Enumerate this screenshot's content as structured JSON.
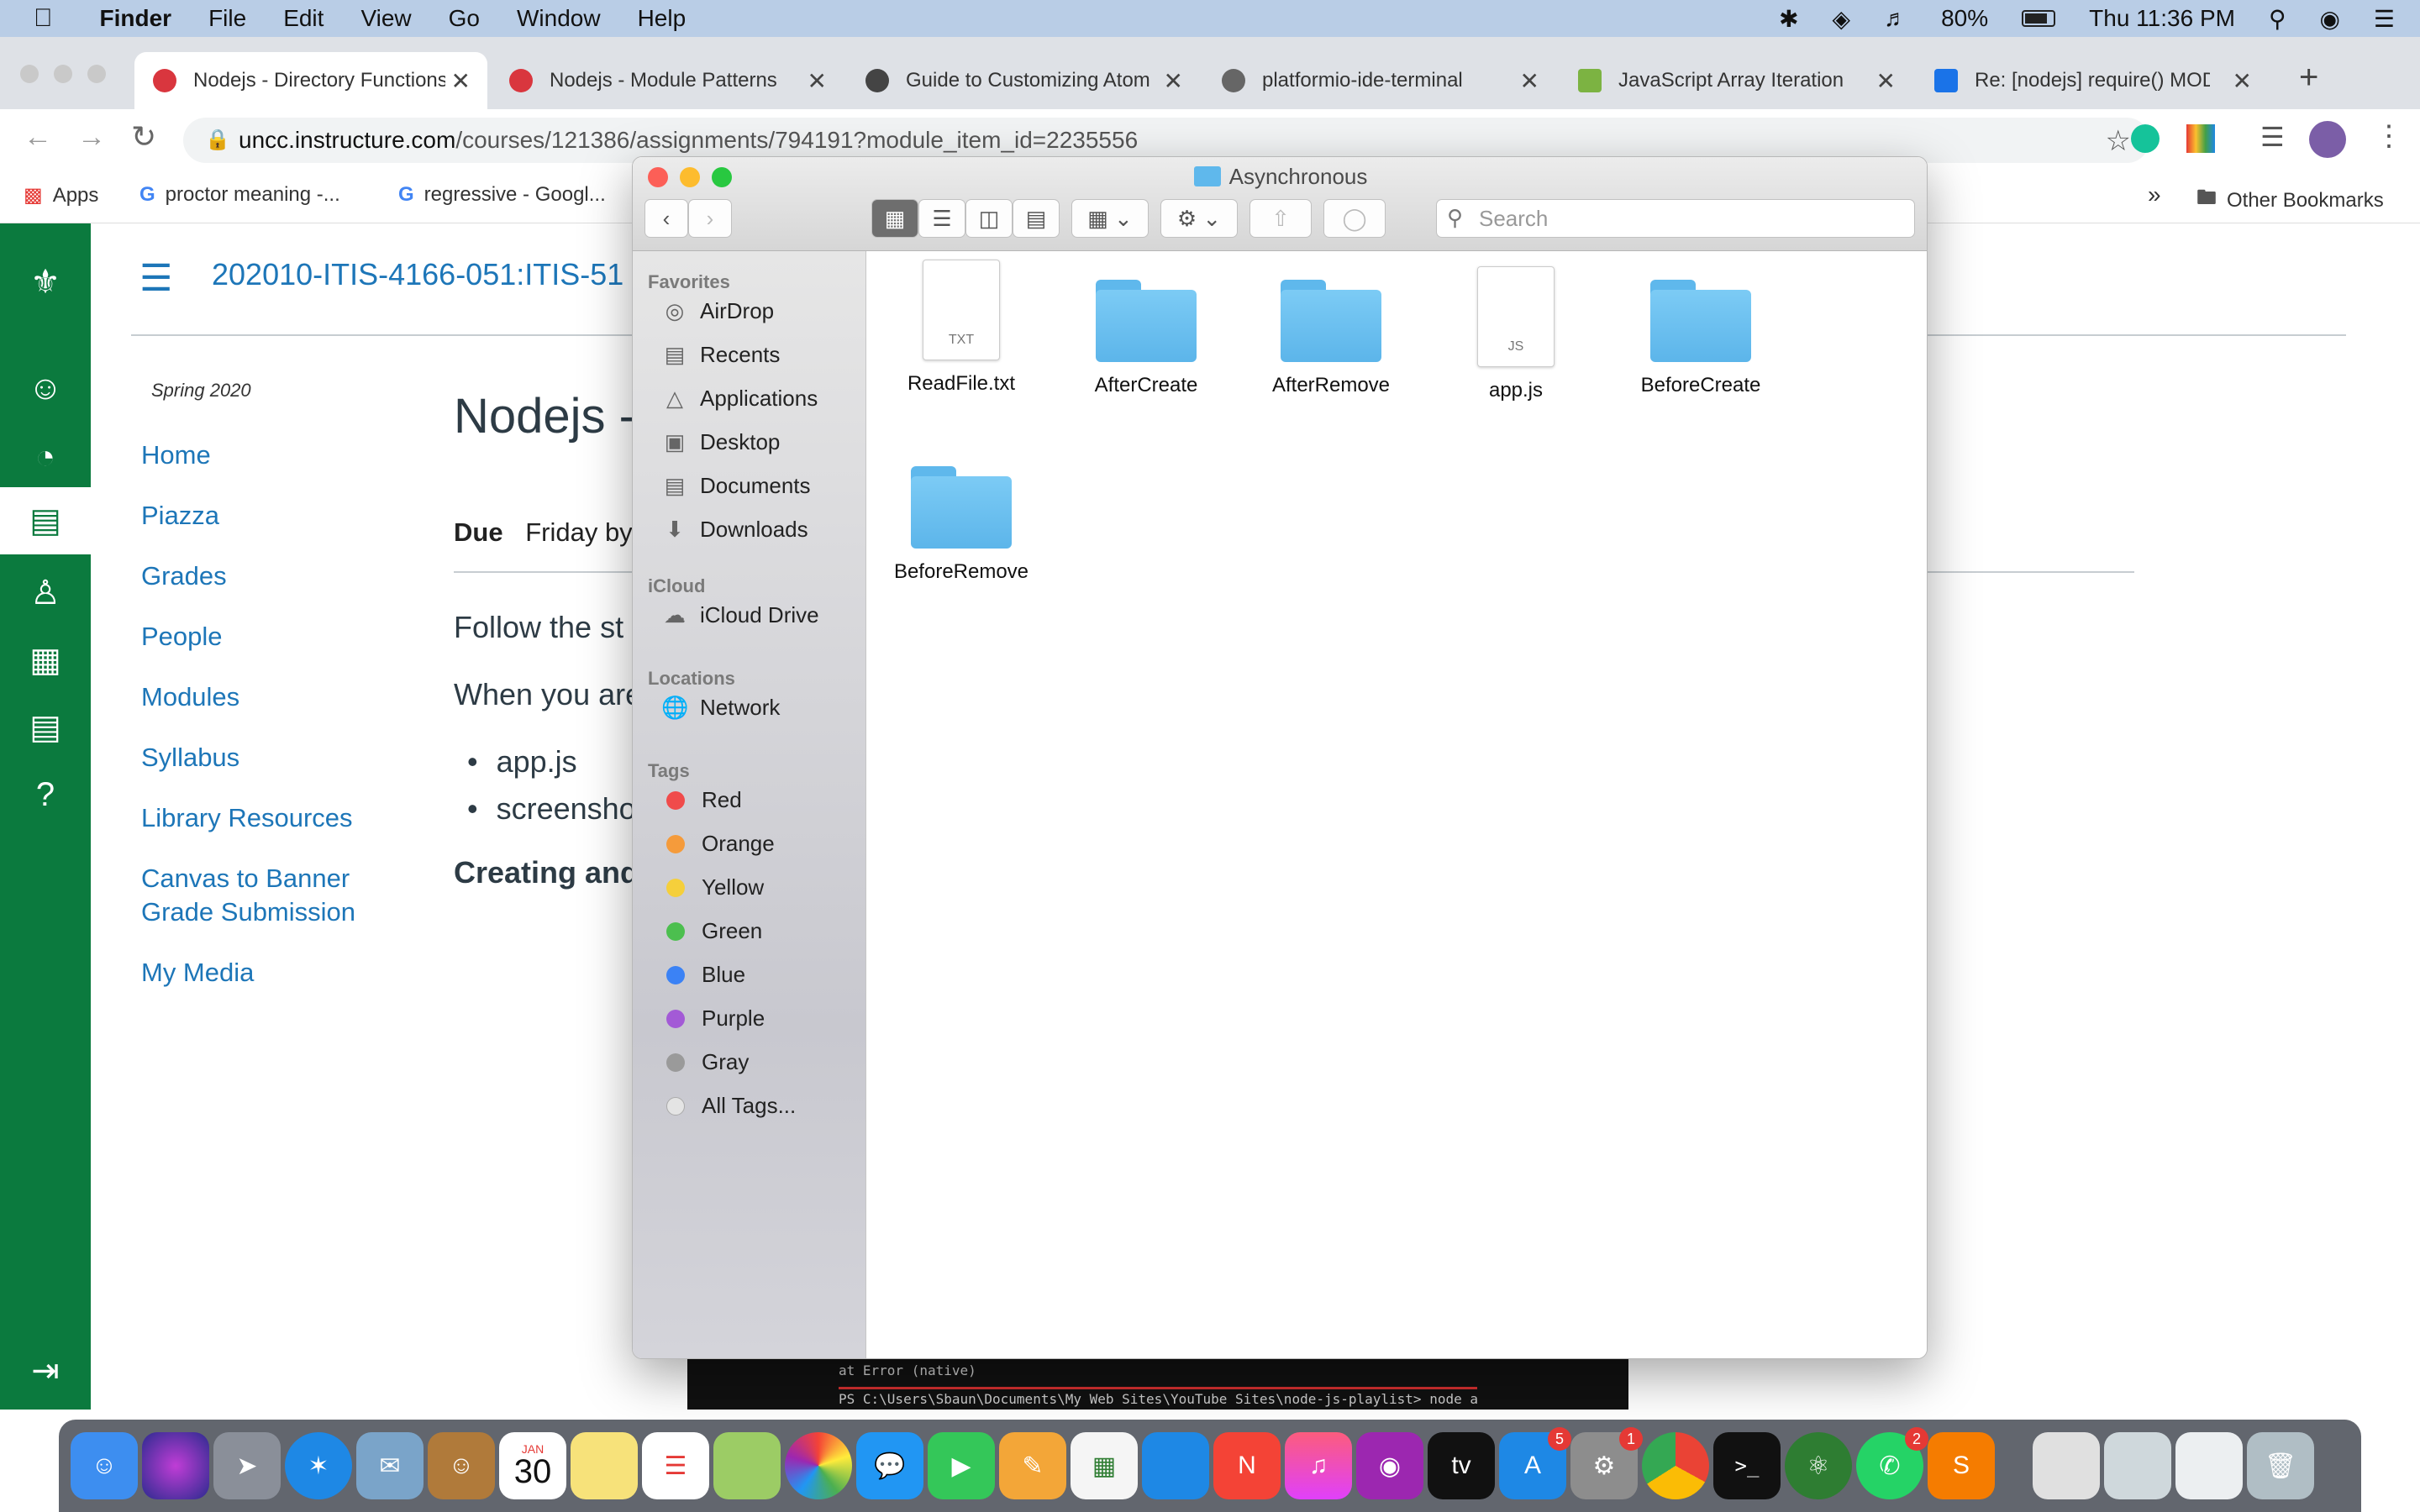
{
  "menubar": {
    "app": "Finder",
    "items": [
      "File",
      "Edit",
      "View",
      "Go",
      "Window",
      "Help"
    ],
    "battery": "80%",
    "clock": "Thu 11:36 PM"
  },
  "browser": {
    "tabs": [
      {
        "title": "Nodejs - Directory Functions",
        "color": "#d9363e"
      },
      {
        "title": "Nodejs - Module Patterns",
        "color": "#d9363e"
      },
      {
        "title": "Guide to Customizing Atom",
        "color": "#444444"
      },
      {
        "title": "platformio-ide-terminal",
        "color": "#666666"
      },
      {
        "title": "JavaScript Array Iteration",
        "color": "#7cb342"
      },
      {
        "title": "Re: [nodejs] require() MODULE",
        "color": "#1a73e8"
      }
    ],
    "url_host": "uncc.instructure.com",
    "url_path": "/courses/121386/assignments/794191?module_item_id=2235556",
    "bookmarks": [
      "Apps",
      "proctor meaning -...",
      "regressive - Googl..."
    ],
    "other_bookmarks": "Other Bookmarks"
  },
  "canvas": {
    "course": "202010-ITIS-4166-051:ITIS-51",
    "term": "Spring 2020",
    "nav": [
      "Home",
      "Piazza",
      "Grades",
      "People",
      "Modules",
      "Syllabus",
      "Library Resources",
      "Canvas to Banner",
      "Grade Submission",
      "My Media"
    ],
    "title": "Nodejs -",
    "due_label": "Due",
    "due_value": "Friday by",
    "p1": "Follow the st",
    "p2": "When you are",
    "bullets": [
      "app.js",
      "screensho"
    ],
    "heading": "Creating and"
  },
  "video": {
    "line1": "at Error (native)",
    "line2": "PS C:\\Users\\Sbaun\\Documents\\My Web Sites\\YouTube Sites\\node-js-playlist> node app"
  },
  "finder": {
    "title": "Asynchronous",
    "search_placeholder": "Search",
    "sections": {
      "favorites": "Favorites",
      "icloud": "iCloud",
      "locations": "Locations",
      "tags": "Tags"
    },
    "favorites": [
      "AirDrop",
      "Recents",
      "Applications",
      "Desktop",
      "Documents",
      "Downloads"
    ],
    "icloud": [
      "iCloud Drive"
    ],
    "locations": [
      "Network"
    ],
    "tags": [
      {
        "name": "Red",
        "color": "#f04b4b"
      },
      {
        "name": "Orange",
        "color": "#f59b3b"
      },
      {
        "name": "Yellow",
        "color": "#f5cf3b"
      },
      {
        "name": "Green",
        "color": "#4cbf4f"
      },
      {
        "name": "Blue",
        "color": "#3b82f5"
      },
      {
        "name": "Purple",
        "color": "#a35ad6"
      },
      {
        "name": "Gray",
        "color": "#9a9a9a"
      }
    ],
    "all_tags": "All Tags...",
    "files": [
      {
        "name": "ReadFile.txt",
        "kind": "doc",
        "ext": "TXT"
      },
      {
        "name": "AfterCreate",
        "kind": "folder"
      },
      {
        "name": "AfterRemove",
        "kind": "folder"
      },
      {
        "name": "app.js",
        "kind": "doc",
        "ext": "JS"
      },
      {
        "name": "BeforeCreate",
        "kind": "folder"
      },
      {
        "name": "BeforeRemove",
        "kind": "folder"
      }
    ]
  },
  "dock": {
    "calendar_month": "JAN",
    "calendar_day": "30",
    "badges": {
      "appstore": "5",
      "prefs": "1",
      "whatsapp": "2"
    }
  }
}
